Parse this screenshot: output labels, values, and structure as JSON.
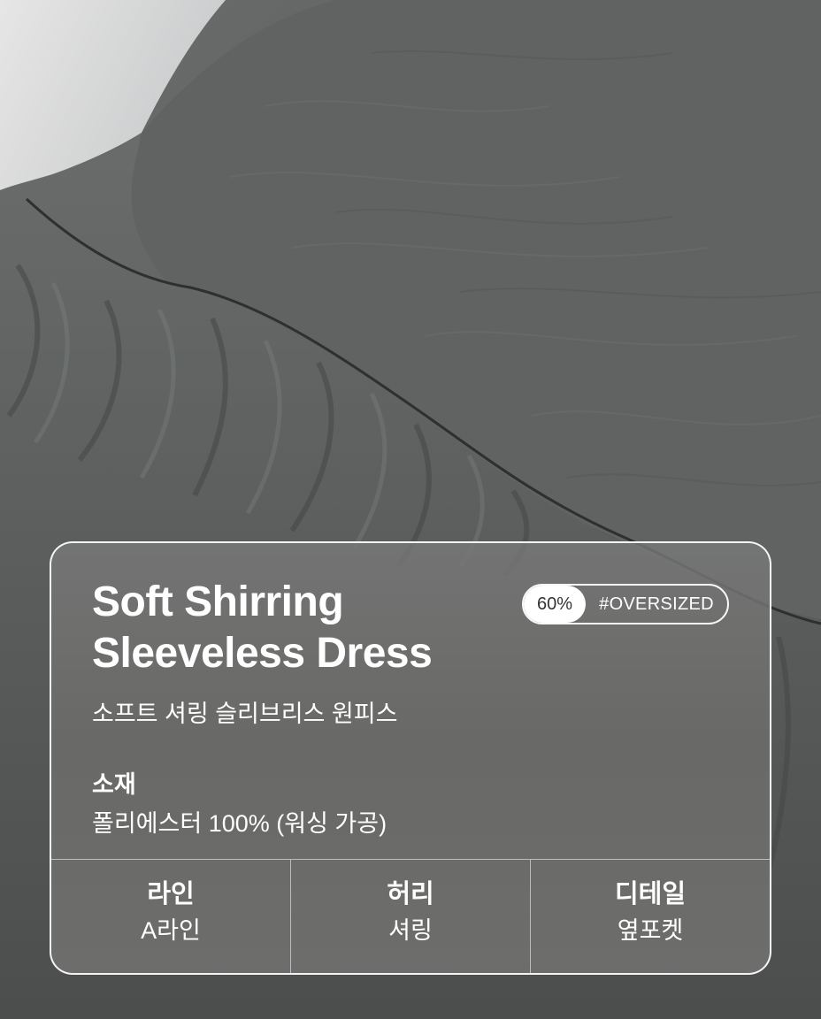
{
  "product": {
    "title_line1": "Soft Shirring",
    "title_line2": "Sleeveless Dress",
    "subtitle": "소프트 셔링 슬리브리스 원피스"
  },
  "fit_badge": {
    "percent": "60%",
    "tag": "#OVERSIZED"
  },
  "material": {
    "label": "소재",
    "value": "폴리에스터 100% (워싱 가공)"
  },
  "specs": [
    {
      "label": "라인",
      "value": "A라인"
    },
    {
      "label": "허리",
      "value": "셔링"
    },
    {
      "label": "디테일",
      "value": "옆포켓"
    }
  ],
  "colors": {
    "fabric": "#5b5d5d",
    "card_border": "#ffffff"
  }
}
